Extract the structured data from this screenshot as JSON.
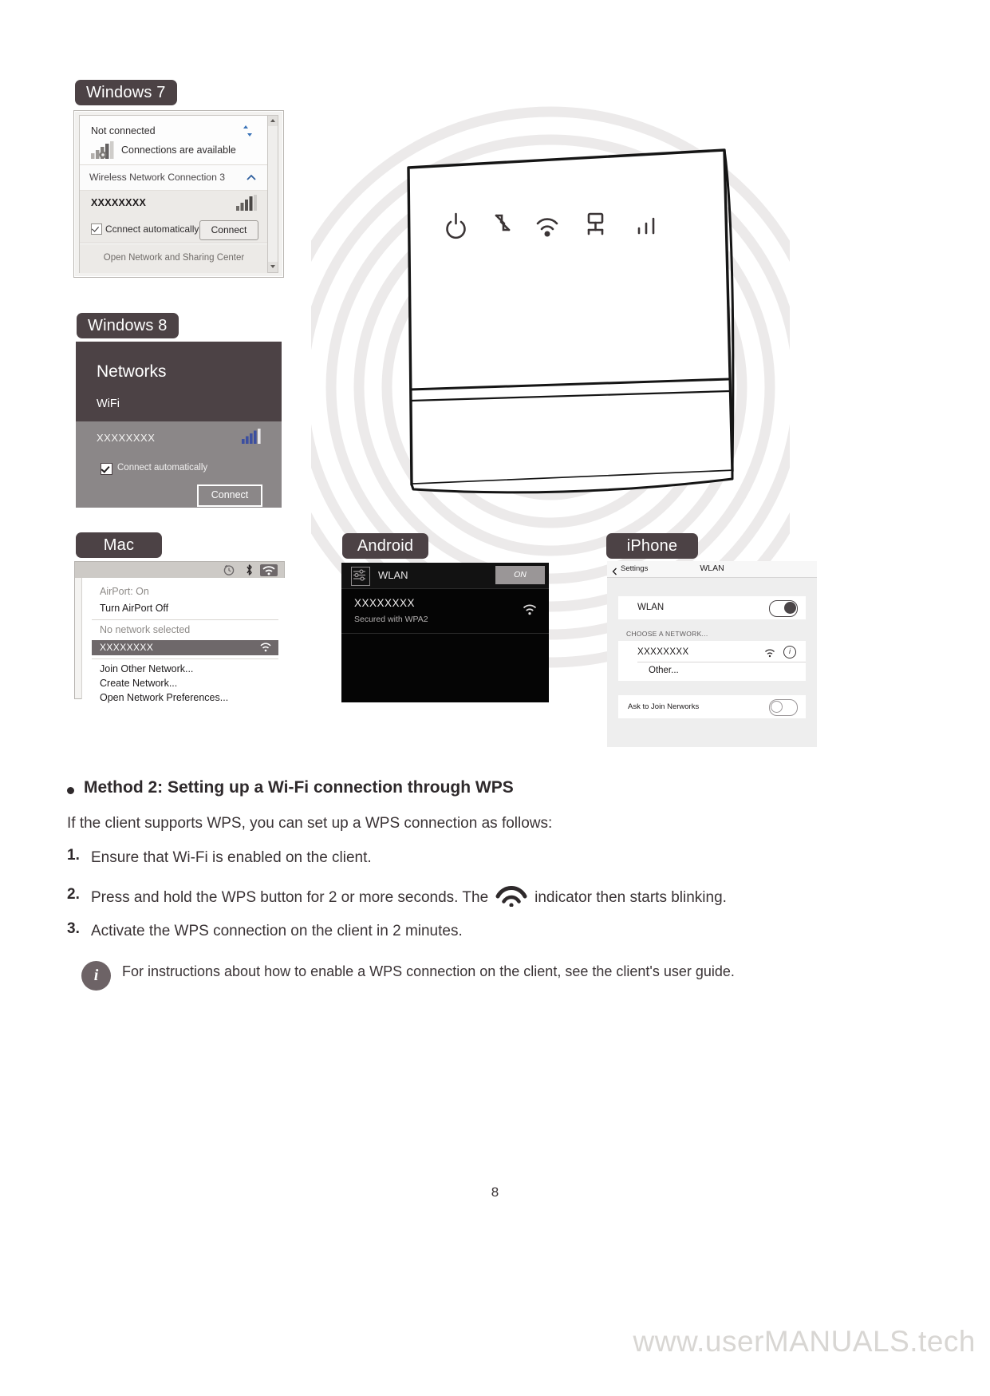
{
  "labels": {
    "win7": "Windows 7",
    "win8": "Windows 8",
    "mac": "Mac",
    "android": "Android",
    "iphone": "iPhone"
  },
  "win7": {
    "not_connected": "Not connected",
    "connections_available": "Connections are available",
    "adapter": "Wireless Network Connection 3",
    "ssid": "XXXXXXXX",
    "connect_automatically": "Ccnnect automatically",
    "connect_button": "Connect",
    "open_center": "Open Network and Sharing Center",
    "icons": {
      "refresh": "refresh-icon",
      "signal": "signal-bars-icon",
      "collapse": "chevron-up-icon",
      "scroll_up": "scroll-up-arrow-icon",
      "scroll_down": "scroll-down-arrow-icon"
    }
  },
  "win8": {
    "title": "Networks",
    "wifi_label": "WiFi",
    "ssid": "XXXXXXXX",
    "connect_automatically": "Connect automatically",
    "connect_button": "Connect",
    "icons": {
      "signal": "signal-bars-icon"
    },
    "colors": {
      "header_bg": "#4c4245",
      "body_bg": "#8b8788"
    }
  },
  "mac": {
    "airport_status": "AirPort: On",
    "turn_off": "Turn AirPort Off",
    "no_network": "No network selected",
    "ssid": "XXXXXXXX",
    "join_other": "Join Other Network...",
    "create_network": "Create Network...",
    "open_prefs": "Open Network Preferences...",
    "icons": {
      "clock": "clock-icon",
      "bluetooth": "bluetooth-icon",
      "wifi": "wifi-icon",
      "row_wifi": "wifi-icon"
    }
  },
  "android": {
    "wlan_label": "WLAN",
    "toggle_state": "ON",
    "ssid": "XXXXXXXX",
    "security": "Secured with WPA2",
    "icons": {
      "settings": "sliders-icon",
      "wifi": "wifi-icon"
    }
  },
  "iphone": {
    "back_label": "Settings",
    "nav_title": "WLAN",
    "wlan_label": "WLAN",
    "wlan_toggle": "on",
    "section_header": "CHOOSE A NETWORK...",
    "ssid": "XXXXXXXX",
    "other": "Other...",
    "ask_to_join": "Ask to Join Nerworks",
    "ask_toggle": "off",
    "icons": {
      "back_chevron": "chevron-left-icon",
      "wifi": "wifi-icon",
      "info": "info-circle-icon"
    }
  },
  "router": {
    "indicator_icons": [
      "power-icon",
      "signal-strength-icon",
      "wifi-icon",
      "lan-icon",
      "bars-icon"
    ]
  },
  "content": {
    "heading": "Method 2: Setting up a Wi-Fi connection through WPS",
    "intro": "If the client supports WPS, you can set up a WPS connection as follows:",
    "steps": [
      {
        "num": "1.",
        "text": "Ensure that Wi-Fi is enabled on the client."
      },
      {
        "num": "2.",
        "text_before": "Press and hold the WPS button for 2 or more seconds. The",
        "text_after": "indicator then starts blinking."
      },
      {
        "num": "3.",
        "text": "Activate the WPS connection on the client in 2 minutes."
      }
    ],
    "note": "For instructions about how to enable a WPS connection on the client, see the client's user guide.",
    "note_icon": "info-icon"
  },
  "footer": {
    "page_number": "8",
    "watermark": "www.userMANUALS.tech"
  }
}
